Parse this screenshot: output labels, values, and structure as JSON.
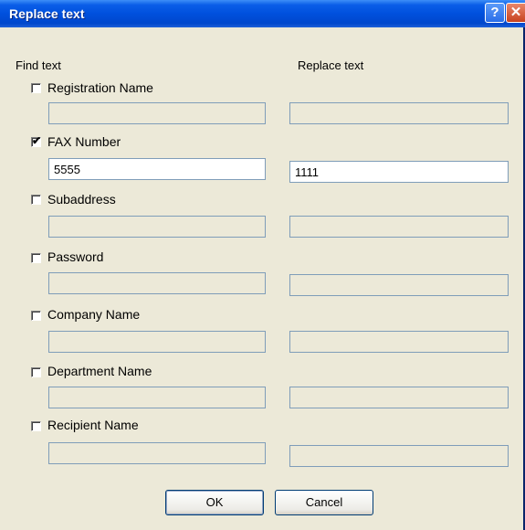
{
  "window": {
    "title": "Replace text",
    "help_glyph": "?",
    "close_glyph": "✕"
  },
  "headers": {
    "find": "Find text",
    "replace": "Replace text"
  },
  "rows": [
    {
      "label": "Registration Name",
      "checked": false,
      "find_value": "",
      "replace_value": ""
    },
    {
      "label": "FAX Number",
      "checked": true,
      "find_value": "5555",
      "replace_value": "1111"
    },
    {
      "label": "Subaddress",
      "checked": false,
      "find_value": "",
      "replace_value": ""
    },
    {
      "label": "Password",
      "checked": false,
      "find_value": "",
      "replace_value": ""
    },
    {
      "label": "Company Name",
      "checked": false,
      "find_value": "",
      "replace_value": ""
    },
    {
      "label": "Department Name",
      "checked": false,
      "find_value": "",
      "replace_value": ""
    },
    {
      "label": "Recipient Name",
      "checked": false,
      "find_value": "",
      "replace_value": ""
    }
  ],
  "buttons": {
    "ok": "OK",
    "cancel": "Cancel"
  },
  "colors": {
    "title_bar": "#0050dd",
    "dialog_bg": "#ece9d8"
  }
}
